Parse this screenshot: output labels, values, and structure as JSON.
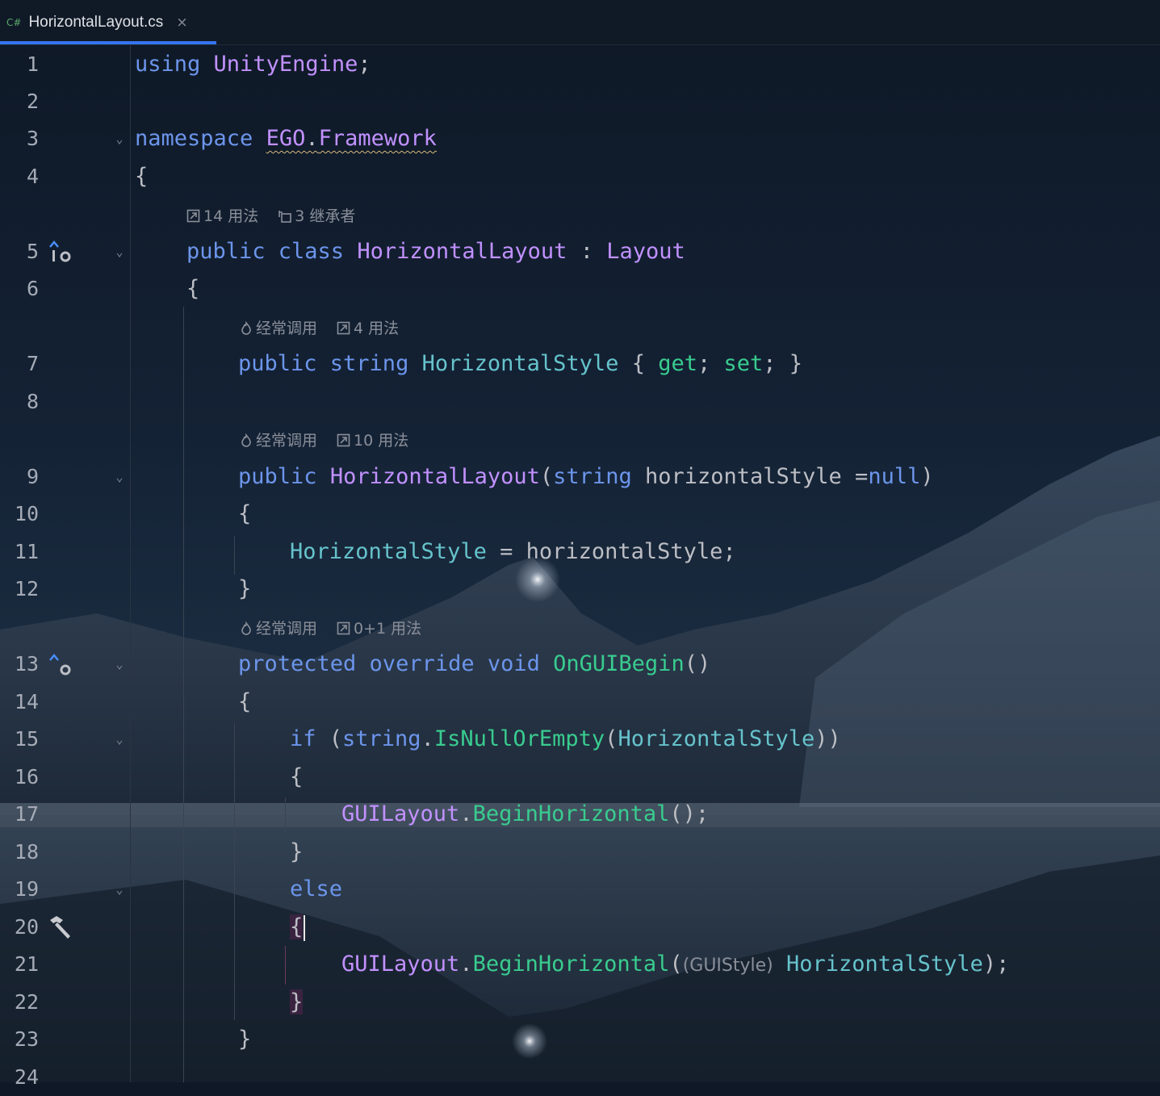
{
  "tab": {
    "language_badge": "C#",
    "file_name": "HorizontalLayout.cs",
    "close_glyph": "×"
  },
  "line_numbers": [
    "1",
    "2",
    "3",
    "4",
    "5",
    "6",
    "7",
    "8",
    "9",
    "10",
    "11",
    "12",
    "13",
    "14",
    "15",
    "16",
    "17",
    "18",
    "19",
    "20",
    "21",
    "22",
    "23",
    "24"
  ],
  "hints": {
    "class_usages": "14 用法",
    "class_inheritors": "3 继承者",
    "prop_frequent": "经常调用",
    "prop_usages": "4 用法",
    "ctor_frequent": "经常调用",
    "ctor_usages": "10 用法",
    "method_frequent": "经常调用",
    "method_usages": "0+1 用法"
  },
  "code": {
    "l1_kw": "using",
    "l1_ns": "UnityEngine",
    "l1_end": ";",
    "l3_kw": "namespace",
    "l3_ns1": "EGO",
    "l3_dot": ".",
    "l3_ns2": "Framework",
    "l4": "{",
    "l5_kw": "public class",
    "l5_name": "HorizontalLayout",
    "l5_colon": " : ",
    "l5_base": "Layout",
    "l6": "{",
    "l7_kw": "public string",
    "l7_prop": "HorizontalStyle",
    "l7_open": " { ",
    "l7_get": "get",
    "l7_semi1": "; ",
    "l7_set": "set",
    "l7_close": "; }",
    "l9_kw": "public",
    "l9_name": "HorizontalLayout",
    "l9_paren": "(",
    "l9_type": "string",
    "l9_param": " horizontalStyle =",
    "l9_null": "null",
    "l9_end": ")",
    "l10": "{",
    "l11_prop": "HorizontalStyle",
    "l11_rest": " = horizontalStyle;",
    "l12": "}",
    "l13_kw": "protected override void",
    "l13_name": "OnGUIBegin",
    "l13_end": "()",
    "l14": "{",
    "l15_kw": "if",
    "l15_open": " (",
    "l15_type": "string",
    "l15_dot": ".",
    "l15_method": "IsNullOrEmpty",
    "l15_paren": "(",
    "l15_prop": "HorizontalStyle",
    "l15_end": "))",
    "l16": "{",
    "l17_class": "GUILayout",
    "l17_dot": ".",
    "l17_method": "BeginHorizontal",
    "l17_end": "();",
    "l18": "}",
    "l19_kw": "else",
    "l20": "{",
    "l21_class": "GUILayout",
    "l21_dot": ".",
    "l21_method": "BeginHorizontal",
    "l21_paren": "(",
    "l21_hint": "(GUIStyle)",
    "l21_prop": "HorizontalStyle",
    "l21_end": ");",
    "l22": "}",
    "l23": "}"
  },
  "colors": {
    "keyword": "#6c95eb",
    "type": "#c191ff",
    "property": "#66c3cc",
    "method": "#39cc8f",
    "text": "#bcbec4",
    "tab_accent": "#3574f0"
  },
  "icons": {
    "tab": [
      "csharp-file-badge",
      "close-icon"
    ],
    "hints": [
      "usages-icon",
      "inheritors-icon",
      "hot-call-icon"
    ],
    "gutter": [
      "implemented-override-icon",
      "overrides-icon",
      "build-hammer-icon",
      "fold-chevron-icon"
    ]
  }
}
